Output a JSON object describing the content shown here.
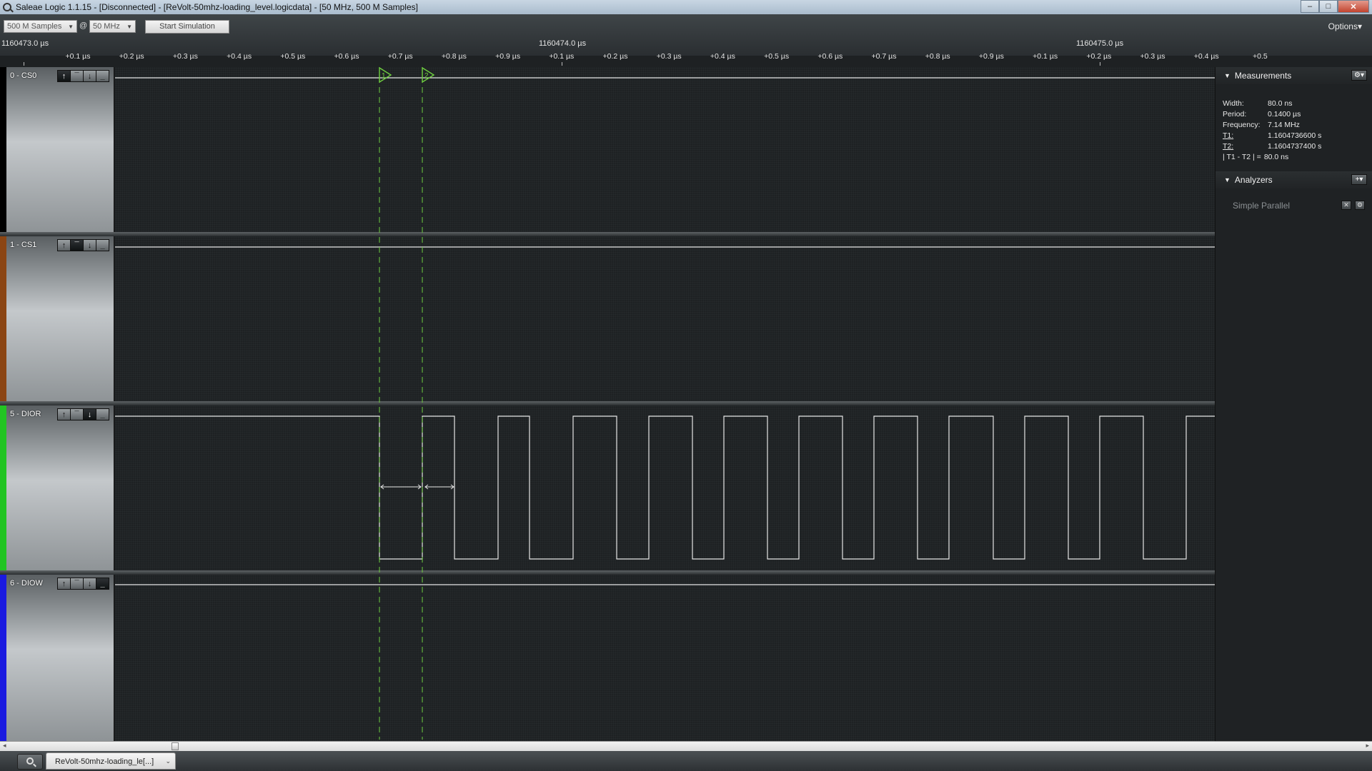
{
  "window": {
    "title": "Saleae Logic 1.1.15 - [Disconnected] - [ReVolt-50mhz-loading_level.logicdata] - [50 MHz, 500 M Samples]",
    "minimize": "–",
    "maximize": "□",
    "close": "✕"
  },
  "toolbar": {
    "samples_value": "500 M Samples",
    "at": "@",
    "rate_value": "50 MHz",
    "start_simulation": "Start Simulation",
    "options": "Options▾"
  },
  "ruler": {
    "major": [
      "1160473.0 µs",
      "1160474.0 µs",
      "1160475.0 µs"
    ],
    "ticks": [
      "+0.1 µs",
      "+0.2 µs",
      "+0.3 µs",
      "+0.4 µs",
      "+0.5 µs",
      "+0.6 µs",
      "+0.7 µs",
      "+0.8 µs",
      "+0.9 µs",
      "+0.1 µs",
      "+0.2 µs",
      "+0.3 µs",
      "+0.4 µs",
      "+0.5 µs",
      "+0.6 µs",
      "+0.7 µs",
      "+0.8 µs",
      "+0.9 µs",
      "+0.1 µs",
      "+0.2 µs",
      "+0.3 µs",
      "+0.4 µs",
      "+0.5"
    ]
  },
  "channels": [
    {
      "name": "0 - CS0",
      "color": "#000000",
      "active_btn": 0
    },
    {
      "name": "1 - CS1",
      "color": "#8b4513",
      "active_btn": 1
    },
    {
      "name": "5 - DIOR",
      "color": "#22c422",
      "active_btn": 2
    },
    {
      "name": "6 - DIOW",
      "color": "#1a1ae0",
      "active_btn": 3
    }
  ],
  "channel_buttons": [
    "↑",
    "¯",
    "↓",
    "_"
  ],
  "markers": {
    "t1": "1",
    "t2": "2",
    "color": "#6fd040"
  },
  "measurements": {
    "header": "Measurements",
    "gear": "⚙▾",
    "rows": [
      {
        "k": "Width:",
        "v": "80.0 ns"
      },
      {
        "k": "Period:",
        "v": "0.1400 µs"
      },
      {
        "k": "Frequency:",
        "v": "7.14 MHz"
      },
      {
        "k": "T1:",
        "v": "1.1604736600 s"
      },
      {
        "k": "T2:",
        "v": "1.1604737400 s"
      },
      {
        "k": "| T1 - T2 | =",
        "v": "80.0 ns"
      }
    ]
  },
  "analyzers": {
    "header": "Analyzers",
    "add": "+▾",
    "items": [
      {
        "name": "Simple Parallel",
        "close": "✕",
        "gear": "⚙"
      }
    ]
  },
  "bottom": {
    "file_tab": "ReVolt-50mhz-loading_le[...]",
    "chev": "⌄"
  }
}
